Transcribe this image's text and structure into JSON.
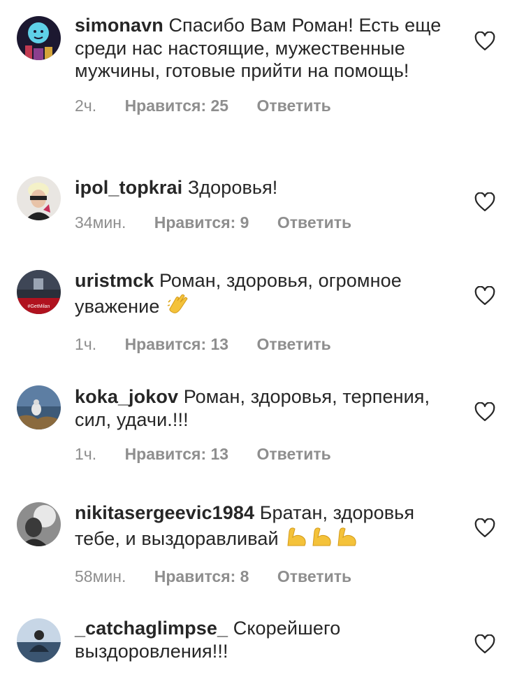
{
  "comments": [
    {
      "username": "simonavn",
      "text": "Спасибо Вам Роман! Есть еще среди нас настоящие, мужественные мужчины, готовые прийти на помощь!",
      "time": "2ч.",
      "likes": "Нравится: 25",
      "reply": "Ответить"
    },
    {
      "username": "ipol_topkrai",
      "text": "Здоровья!",
      "time": "34мин.",
      "likes": "Нравится: 9",
      "reply": "Ответить"
    },
    {
      "username": "uristmck",
      "text": "Роман, здоровья, огромное уважение",
      "emoji": "👏",
      "avatar_caption": "#GetMilan",
      "time": "1ч.",
      "likes": "Нравится: 13",
      "reply": "Ответить"
    },
    {
      "username": "koka_jokov",
      "text": "Роман, здоровья, терпения, сил, удачи.!!!",
      "time": "1ч.",
      "likes": "Нравится: 13",
      "reply": "Ответить"
    },
    {
      "username": "nikitasergeevic1984",
      "text": "Братан, здоровья тебе, и выздоравливай",
      "emoji": "💪💪💪",
      "time": "58мин.",
      "likes": "Нравится: 8",
      "reply": "Ответить"
    },
    {
      "username": "_catchaglimpse_",
      "text": "Скорейшего выздоровления!!!"
    }
  ],
  "icons": {
    "like": "heart-outline-icon"
  },
  "colors": {
    "text": "#262626",
    "secondary": "#8e8e8e"
  }
}
